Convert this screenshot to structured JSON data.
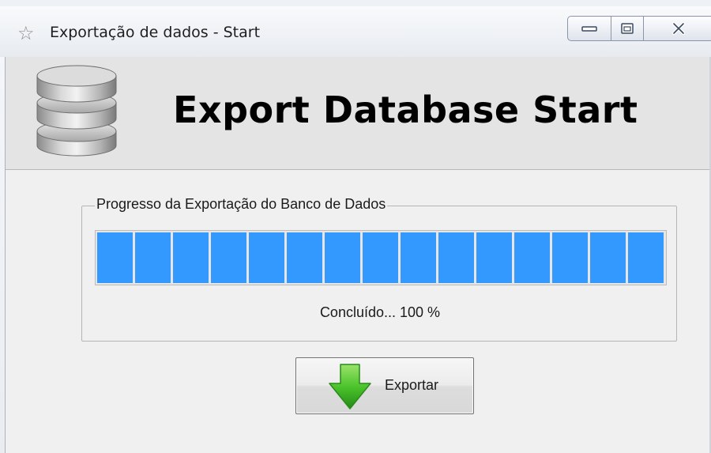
{
  "window": {
    "title": "Exportação de dados - Start",
    "title_icon": "star-icon",
    "caption_buttons": [
      "minimize-icon",
      "maximize-icon",
      "close-icon"
    ]
  },
  "header": {
    "icon": "database-icon",
    "title": "Export Database Start"
  },
  "progress_group": {
    "legend": "Progresso da Exportação do Banco de Dados",
    "progress_fraction": 1.0,
    "status_text": "Concluído... 100 %",
    "bar_color": "#3399ff"
  },
  "export_button": {
    "label": "Exportar",
    "icon": "down-arrow-icon",
    "icon_color": "#3cb521"
  }
}
